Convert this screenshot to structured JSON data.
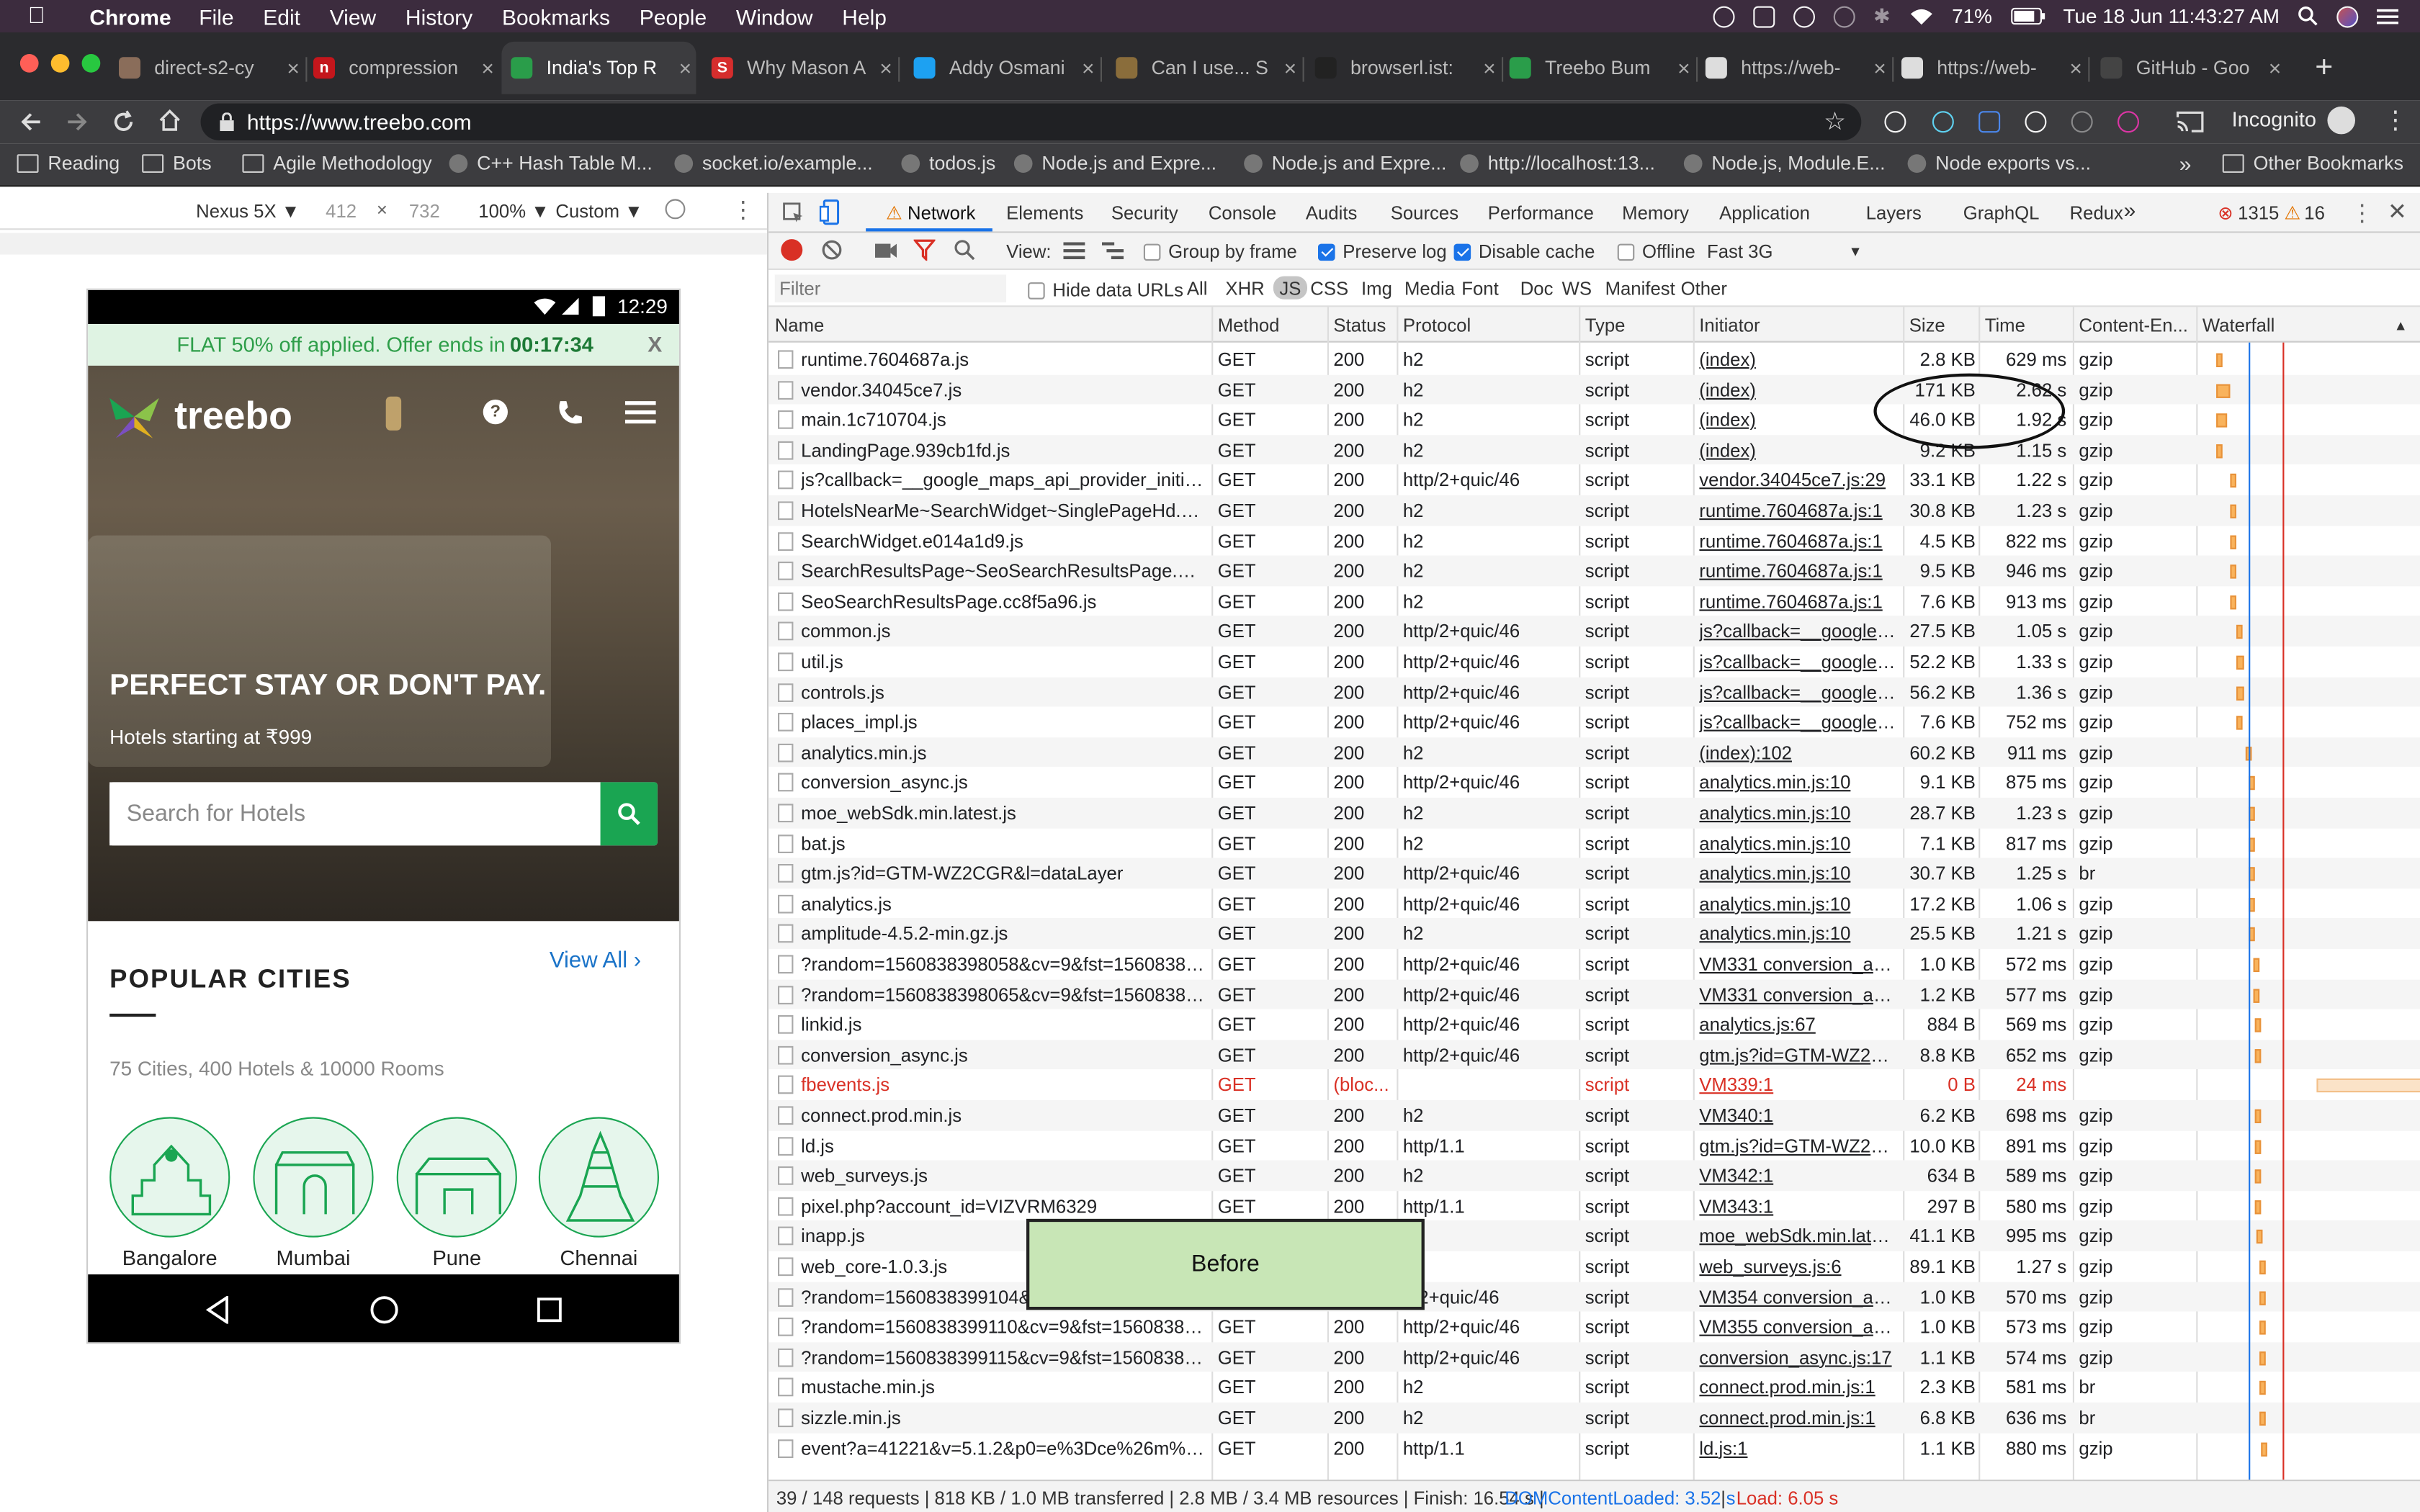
{
  "menubar": {
    "app": "Chrome",
    "items": [
      "File",
      "Edit",
      "View",
      "History",
      "Bookmarks",
      "People",
      "Window",
      "Help"
    ],
    "battery": "71%",
    "datetime": "Tue 18 Jun  11:43:27 AM"
  },
  "tabs": [
    {
      "title": "direct-s2-cy",
      "fav_color": "#8a6d5a",
      "fav_char": ""
    },
    {
      "title": "compression",
      "fav_color": "#c4161c",
      "fav_char": "n"
    },
    {
      "title": "India's Top R",
      "fav_color": "#2a9d4a",
      "fav_char": "",
      "active": true
    },
    {
      "title": "Why Mason A",
      "fav_color": "#d62d2d",
      "fav_char": "S"
    },
    {
      "title": "Addy Osmani",
      "fav_color": "#1da1f2",
      "fav_char": ""
    },
    {
      "title": "Can I use... S",
      "fav_color": "#8a6d3b",
      "fav_char": ""
    },
    {
      "title": "browserl.ist:",
      "fav_color": "#222222",
      "fav_char": ""
    },
    {
      "title": "Treebo Bum",
      "fav_color": "#2a9d4a",
      "fav_char": ""
    },
    {
      "title": "https://web-",
      "fav_color": "#dddddd",
      "fav_char": ""
    },
    {
      "title": "https://web-",
      "fav_color": "#dddddd",
      "fav_char": ""
    },
    {
      "title": "GitHub - Goo",
      "fav_color": "#444444",
      "fav_char": ""
    }
  ],
  "toolbar": {
    "url": "https://www.treebo.com",
    "profile": "Incognito"
  },
  "bookmarks": [
    {
      "label": "Reading",
      "type": "folder"
    },
    {
      "label": "Bots",
      "type": "folder"
    },
    {
      "label": "Agile Methodology",
      "type": "folder"
    },
    {
      "label": "C++ Hash Table M...",
      "type": "site"
    },
    {
      "label": "socket.io/example...",
      "type": "site"
    },
    {
      "label": "todos.js",
      "type": "site"
    },
    {
      "label": "Node.js and Expre...",
      "type": "site"
    },
    {
      "label": "Node.js and Expre...",
      "type": "site"
    },
    {
      "label": "http://localhost:13...",
      "type": "site"
    },
    {
      "label": "Node.js, Module.E...",
      "type": "site"
    },
    {
      "label": "Node exports vs...",
      "type": "site"
    }
  ],
  "bookmarks_overflow": "»",
  "bookmarks_other": "Other Bookmarks",
  "device": {
    "name": "Nexus 5X ▼",
    "width": "412",
    "height": "732",
    "times": "×",
    "zoom": "100% ▼",
    "throttle": "Custom ▼"
  },
  "phone": {
    "time": "12:29",
    "offer_text": "FLAT 50% off applied. Offer ends in ",
    "offer_timer": "00:17:34",
    "offer_close": "X",
    "brand": "treebo",
    "hero_title": "PERFECT STAY OR DON'T PAY.",
    "hero_sub": "Hotels starting at ₹999",
    "search_placeholder": "Search for Hotels",
    "popular_title": "POPULAR CITIES",
    "view_all": "View All ›",
    "popular_sub": "75 Cities, 400 Hotels & 10000 Rooms",
    "cities": [
      "Bangalore",
      "Mumbai",
      "Pune",
      "Chennai"
    ]
  },
  "devtools": {
    "tabs": [
      "Network",
      "Elements",
      "Security",
      "Console",
      "Audits",
      "Sources",
      "Performance",
      "Memory",
      "Application",
      "Layers",
      "GraphQL",
      "Redux"
    ],
    "overflow": "»",
    "errors": "1315",
    "warnings": "16",
    "view_label": "View:",
    "group_by_frame": "Group by frame",
    "preserve_log": "Preserve log",
    "disable_cache": "Disable cache",
    "offline": "Offline",
    "throttle": "Fast 3G",
    "filter_placeholder": "Filter",
    "hide_data_urls": "Hide data URLs",
    "filter_types": [
      "All",
      "XHR",
      "JS",
      "CSS",
      "Img",
      "Media",
      "Font",
      "Doc",
      "WS",
      "Manifest",
      "Other"
    ],
    "active_filter": "JS",
    "columns": [
      "Name",
      "Method",
      "Status",
      "Protocol",
      "Type",
      "Initiator",
      "Size",
      "Time",
      "Content-En...",
      "Waterfall"
    ],
    "rows": [
      {
        "name": "runtime.7604687a.js",
        "method": "GET",
        "status": "200",
        "protocol": "h2",
        "type": "script",
        "initiator": "(index)",
        "size": "2.8 KB",
        "time": "629 ms",
        "enc": "gzip",
        "ws": 0.006,
        "wd": 0.004
      },
      {
        "name": "vendor.34045ce7.js",
        "method": "GET",
        "status": "200",
        "protocol": "h2",
        "type": "script",
        "initiator": "(index)",
        "size": "171 KB",
        "time": "2.62 s",
        "enc": "gzip",
        "ws": 0.006,
        "wd": 0.016
      },
      {
        "name": "main.1c710704.js",
        "method": "GET",
        "status": "200",
        "protocol": "h2",
        "type": "script",
        "initiator": "(index)",
        "size": "46.0 KB",
        "time": "1.92 s",
        "enc": "gzip",
        "ws": 0.006,
        "wd": 0.012
      },
      {
        "name": "LandingPage.939cb1fd.js",
        "method": "GET",
        "status": "200",
        "protocol": "h2",
        "type": "script",
        "initiator": "(index)",
        "size": "9.2 KB",
        "time": "1.15 s",
        "enc": "gzip",
        "ws": 0.006,
        "wd": 0.007
      },
      {
        "name": "js?callback=__google_maps_api_provider_initializ...",
        "method": "GET",
        "status": "200",
        "protocol": "http/2+quic/46",
        "type": "script",
        "initiator": "vendor.34045ce7.js:29",
        "size": "33.1 KB",
        "time": "1.22 s",
        "enc": "gzip",
        "ws": 0.022,
        "wd": 0.007
      },
      {
        "name": "HotelsNearMe~SearchWidget~SinglePageHd.ded...",
        "method": "GET",
        "status": "200",
        "protocol": "h2",
        "type": "script",
        "initiator": "runtime.7604687a.js:1",
        "size": "30.8 KB",
        "time": "1.23 s",
        "enc": "gzip",
        "ws": 0.022,
        "wd": 0.007
      },
      {
        "name": "SearchWidget.e014a1d9.js",
        "method": "GET",
        "status": "200",
        "protocol": "h2",
        "type": "script",
        "initiator": "runtime.7604687a.js:1",
        "size": "4.5 KB",
        "time": "822 ms",
        "enc": "gzip",
        "ws": 0.022,
        "wd": 0.005
      },
      {
        "name": "SearchResultsPage~SeoSearchResultsPage.6e50...",
        "method": "GET",
        "status": "200",
        "protocol": "h2",
        "type": "script",
        "initiator": "runtime.7604687a.js:1",
        "size": "9.5 KB",
        "time": "946 ms",
        "enc": "gzip",
        "ws": 0.022,
        "wd": 0.005
      },
      {
        "name": "SeoSearchResultsPage.cc8f5a96.js",
        "method": "GET",
        "status": "200",
        "protocol": "h2",
        "type": "script",
        "initiator": "runtime.7604687a.js:1",
        "size": "7.6 KB",
        "time": "913 ms",
        "enc": "gzip",
        "ws": 0.022,
        "wd": 0.005
      },
      {
        "name": "common.js",
        "method": "GET",
        "status": "200",
        "protocol": "http/2+quic/46",
        "type": "script",
        "initiator": "js?callback=__google_...",
        "size": "27.5 KB",
        "time": "1.05 s",
        "enc": "gzip",
        "ws": 0.029,
        "wd": 0.006
      },
      {
        "name": "util.js",
        "method": "GET",
        "status": "200",
        "protocol": "http/2+quic/46",
        "type": "script",
        "initiator": "js?callback=__google_...",
        "size": "52.2 KB",
        "time": "1.33 s",
        "enc": "gzip",
        "ws": 0.029,
        "wd": 0.008
      },
      {
        "name": "controls.js",
        "method": "GET",
        "status": "200",
        "protocol": "http/2+quic/46",
        "type": "script",
        "initiator": "js?callback=__google_...",
        "size": "56.2 KB",
        "time": "1.36 s",
        "enc": "gzip",
        "ws": 0.029,
        "wd": 0.008
      },
      {
        "name": "places_impl.js",
        "method": "GET",
        "status": "200",
        "protocol": "http/2+quic/46",
        "type": "script",
        "initiator": "js?callback=__google_...",
        "size": "7.6 KB",
        "time": "752 ms",
        "enc": "gzip",
        "ws": 0.029,
        "wd": 0.004
      },
      {
        "name": "analytics.min.js",
        "method": "GET",
        "status": "200",
        "protocol": "h2",
        "type": "script",
        "initiator": "(index):102",
        "size": "60.2 KB",
        "time": "911 ms",
        "enc": "gzip",
        "ws": 0.039,
        "wd": 0.005
      },
      {
        "name": "conversion_async.js",
        "method": "GET",
        "status": "200",
        "protocol": "http/2+quic/46",
        "type": "script",
        "initiator": "analytics.min.js:10",
        "size": "9.1 KB",
        "time": "875 ms",
        "enc": "gzip",
        "ws": 0.043,
        "wd": 0.005
      },
      {
        "name": "moe_webSdk.min.latest.js",
        "method": "GET",
        "status": "200",
        "protocol": "h2",
        "type": "script",
        "initiator": "analytics.min.js:10",
        "size": "28.7 KB",
        "time": "1.23 s",
        "enc": "gzip",
        "ws": 0.043,
        "wd": 0.007
      },
      {
        "name": "bat.js",
        "method": "GET",
        "status": "200",
        "protocol": "h2",
        "type": "script",
        "initiator": "analytics.min.js:10",
        "size": "7.1 KB",
        "time": "817 ms",
        "enc": "gzip",
        "ws": 0.043,
        "wd": 0.005
      },
      {
        "name": "gtm.js?id=GTM-WZ2CGR&l=dataLayer",
        "method": "GET",
        "status": "200",
        "protocol": "http/2+quic/46",
        "type": "script",
        "initiator": "analytics.min.js:10",
        "size": "30.7 KB",
        "time": "1.25 s",
        "enc": "br",
        "ws": 0.043,
        "wd": 0.007
      },
      {
        "name": "analytics.js",
        "method": "GET",
        "status": "200",
        "protocol": "http/2+quic/46",
        "type": "script",
        "initiator": "analytics.min.js:10",
        "size": "17.2 KB",
        "time": "1.06 s",
        "enc": "gzip",
        "ws": 0.043,
        "wd": 0.006
      },
      {
        "name": "amplitude-4.5.2-min.gz.js",
        "method": "GET",
        "status": "200",
        "protocol": "h2",
        "type": "script",
        "initiator": "analytics.min.js:10",
        "size": "25.5 KB",
        "time": "1.21 s",
        "enc": "gzip",
        "ws": 0.043,
        "wd": 0.007
      },
      {
        "name": "?random=1560838398058&cv=9&fst=156083839...",
        "method": "GET",
        "status": "200",
        "protocol": "http/2+quic/46",
        "type": "script",
        "initiator": "VM331 conversion_as...",
        "size": "1.0 KB",
        "time": "572 ms",
        "enc": "gzip",
        "ws": 0.048,
        "wd": 0.003
      },
      {
        "name": "?random=1560838398065&cv=9&fst=156083839...",
        "method": "GET",
        "status": "200",
        "protocol": "http/2+quic/46",
        "type": "script",
        "initiator": "VM331 conversion_as...",
        "size": "1.2 KB",
        "time": "577 ms",
        "enc": "gzip",
        "ws": 0.048,
        "wd": 0.003
      },
      {
        "name": "linkid.js",
        "method": "GET",
        "status": "200",
        "protocol": "http/2+quic/46",
        "type": "script",
        "initiator": "analytics.js:67",
        "size": "884 B",
        "time": "569 ms",
        "enc": "gzip",
        "ws": 0.049,
        "wd": 0.003
      },
      {
        "name": "conversion_async.js",
        "method": "GET",
        "status": "200",
        "protocol": "http/2+quic/46",
        "type": "script",
        "initiator": "gtm.js?id=GTM-WZ2C...",
        "size": "8.8 KB",
        "time": "652 ms",
        "enc": "gzip",
        "ws": 0.05,
        "wd": 0.004
      },
      {
        "name": "fbevents.js",
        "method": "GET",
        "status": "(bloc...",
        "protocol": "",
        "type": "script",
        "initiator": "VM339:1",
        "size": "0 B",
        "time": "24 ms",
        "enc": "",
        "ws": 0.05,
        "wd": 0.5,
        "error": true
      },
      {
        "name": "connect.prod.min.js",
        "method": "GET",
        "status": "200",
        "protocol": "h2",
        "type": "script",
        "initiator": "VM340:1",
        "size": "6.2 KB",
        "time": "698 ms",
        "enc": "gzip",
        "ws": 0.05,
        "wd": 0.004
      },
      {
        "name": "ld.js",
        "method": "GET",
        "status": "200",
        "protocol": "http/1.1",
        "type": "script",
        "initiator": "gtm.js?id=GTM-WZ2C...",
        "size": "10.0 KB",
        "time": "891 ms",
        "enc": "gzip",
        "ws": 0.05,
        "wd": 0.005
      },
      {
        "name": "web_surveys.js",
        "method": "GET",
        "status": "200",
        "protocol": "h2",
        "type": "script",
        "initiator": "VM342:1",
        "size": "634 B",
        "time": "589 ms",
        "enc": "gzip",
        "ws": 0.05,
        "wd": 0.003
      },
      {
        "name": "pixel.php?account_id=VIZVRM6329",
        "method": "GET",
        "status": "200",
        "protocol": "http/1.1",
        "type": "script",
        "initiator": "VM343:1",
        "size": "297 B",
        "time": "580 ms",
        "enc": "gzip",
        "ws": 0.05,
        "wd": 0.003
      },
      {
        "name": "inapp.js",
        "method": "",
        "status": "",
        "protocol": "",
        "type": "script",
        "initiator": "moe_webSdk.min.late...",
        "size": "41.1 KB",
        "time": "995 ms",
        "enc": "gzip",
        "ws": 0.051,
        "wd": 0.006
      },
      {
        "name": "web_core-1.0.3.js",
        "method": "",
        "status": "",
        "protocol": "",
        "type": "script",
        "initiator": "web_surveys.js:6",
        "size": "89.1 KB",
        "time": "1.27 s",
        "enc": "gzip",
        "ws": 0.054,
        "wd": 0.007
      },
      {
        "name": "?random=1560838399104&c",
        "method": "",
        "status": "",
        "protocol": "p/2+quic/46",
        "type": "script",
        "initiator": "VM354 conversion_as...",
        "size": "1.0 KB",
        "time": "570 ms",
        "enc": "gzip",
        "ws": 0.055,
        "wd": 0.003
      },
      {
        "name": "?random=1560838399110&cv=9&fst=156083839...",
        "method": "GET",
        "status": "200",
        "protocol": "http/2+quic/46",
        "type": "script",
        "initiator": "VM355 conversion_as...",
        "size": "1.0 KB",
        "time": "573 ms",
        "enc": "gzip",
        "ws": 0.055,
        "wd": 0.003
      },
      {
        "name": "?random=1560838399115&cv=9&fst=156083839...",
        "method": "GET",
        "status": "200",
        "protocol": "http/2+quic/46",
        "type": "script",
        "initiator": "conversion_async.js:17",
        "size": "1.1 KB",
        "time": "574 ms",
        "enc": "gzip",
        "ws": 0.055,
        "wd": 0.003
      },
      {
        "name": "mustache.min.js",
        "method": "GET",
        "status": "200",
        "protocol": "h2",
        "type": "script",
        "initiator": "connect.prod.min.js:1",
        "size": "2.3 KB",
        "time": "581 ms",
        "enc": "br",
        "ws": 0.055,
        "wd": 0.003
      },
      {
        "name": "sizzle.min.js",
        "method": "GET",
        "status": "200",
        "protocol": "h2",
        "type": "script",
        "initiator": "connect.prod.min.js:1",
        "size": "6.8 KB",
        "time": "636 ms",
        "enc": "br",
        "ws": 0.055,
        "wd": 0.003
      },
      {
        "name": "event?a=41221&v=5.1.2&p0=e%3Dce%26m%3...",
        "method": "GET",
        "status": "200",
        "protocol": "http/1.1",
        "type": "script",
        "initiator": "ld.js:1",
        "size": "1.1 KB",
        "time": "880 ms",
        "enc": "gzip",
        "ws": 0.057,
        "wd": 0.005
      }
    ],
    "footer_main": "39 / 148 requests | 818 KB / 1.0 MB transferred | 2.8 MB / 3.4 MB resources | Finish: 16.54 s | ",
    "footer_dcl": "DOMContentLoaded: 3.52 s",
    "footer_sep": " | ",
    "footer_load": "Load: 6.05 s"
  },
  "annotation": {
    "label": "Before"
  }
}
